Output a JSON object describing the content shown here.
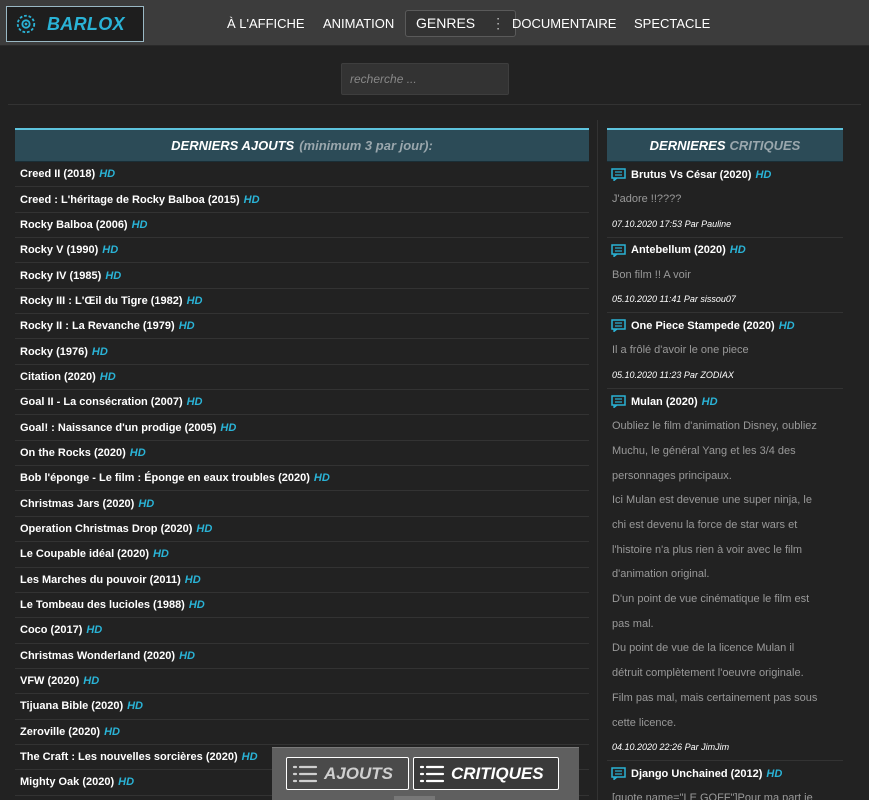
{
  "brand": {
    "name": "BARLOX"
  },
  "nav": [
    {
      "label": "À L'AFFICHE"
    },
    {
      "label": "ANIMATION"
    },
    {
      "label": "GENRES"
    },
    {
      "label": "DOCUMENTAIRE"
    },
    {
      "label": "SPECTACLE"
    }
  ],
  "search": {
    "placeholder": "recherche ..."
  },
  "latest": {
    "title": "DERNIERS AJOUTS",
    "subtitle": "(minimum 3 par jour):",
    "items": [
      {
        "title": "Creed II (2018)",
        "badge": "HD"
      },
      {
        "title": "Creed : L'héritage de Rocky Balboa (2015)",
        "badge": "HD"
      },
      {
        "title": "Rocky Balboa (2006)",
        "badge": "HD"
      },
      {
        "title": "Rocky V (1990)",
        "badge": "HD"
      },
      {
        "title": "Rocky IV (1985)",
        "badge": "HD"
      },
      {
        "title": "Rocky III : L'Œil du Tigre (1982)",
        "badge": "HD"
      },
      {
        "title": "Rocky II : La Revanche (1979)",
        "badge": "HD"
      },
      {
        "title": "Rocky (1976)",
        "badge": "HD"
      },
      {
        "title": "Citation (2020)",
        "badge": "HD"
      },
      {
        "title": "Goal II - La consécration (2007)",
        "badge": "HD"
      },
      {
        "title": "Goal! : Naissance d'un prodige (2005)",
        "badge": "HD"
      },
      {
        "title": "On the Rocks (2020)",
        "badge": "HD"
      },
      {
        "title": "Bob l'éponge - Le film : Éponge en eaux troubles (2020)",
        "badge": "HD"
      },
      {
        "title": "Christmas Jars (2020)",
        "badge": "HD"
      },
      {
        "title": "Operation Christmas Drop (2020)",
        "badge": "HD"
      },
      {
        "title": "Le Coupable idéal (2020)",
        "badge": "HD"
      },
      {
        "title": "Les Marches du pouvoir (2011)",
        "badge": "HD"
      },
      {
        "title": "Le Tombeau des lucioles (1988)",
        "badge": "HD"
      },
      {
        "title": "Coco (2017)",
        "badge": "HD"
      },
      {
        "title": "Christmas Wonderland (2020)",
        "badge": "HD"
      },
      {
        "title": "VFW (2020)",
        "badge": "HD"
      },
      {
        "title": "Tijuana Bible (2020)",
        "badge": "HD"
      },
      {
        "title": "Zeroville (2020)",
        "badge": "HD"
      },
      {
        "title": "The Craft : Les nouvelles sorcières (2020)",
        "badge": "HD"
      },
      {
        "title": "Mighty Oak (2020)",
        "badge": "HD"
      }
    ]
  },
  "critiques": {
    "title": "DERNIERES",
    "subtitle": "CRITIQUES",
    "reviews": [
      {
        "movie": "Brutus Vs César (2020)",
        "badge": "HD",
        "lines": [
          "J'adore !!????"
        ],
        "meta": "07.10.2020 17:53 Par Pauline"
      },
      {
        "movie": "Antebellum (2020)",
        "badge": "HD",
        "lines": [
          "Bon film !! A voir"
        ],
        "meta": "05.10.2020 11:41 Par sissou07"
      },
      {
        "movie": "One Piece Stampede (2020)",
        "badge": "HD",
        "lines": [
          "Il a frôlé d'avoir le one piece"
        ],
        "meta": "05.10.2020 11:23 Par ZODIAX"
      },
      {
        "movie": "Mulan (2020)",
        "badge": "HD",
        "lines": [
          "Oubliez le film d'animation Disney, oubliez",
          "Muchu, le général Yang et les 3/4 des",
          "personnages principaux.",
          "Ici Mulan est devenue une super ninja, le",
          "chi est devenu la force de star wars et",
          "l'histoire n'a plus rien à voir avec le film",
          "d'animation original.",
          "D'un point de vue cinématique le film est",
          "pas mal.",
          "Du point de vue de la licence Mulan il",
          "détruit complètement l'oeuvre originale.",
          "Film pas mal, mais certainement pas sous",
          "cette licence."
        ],
        "meta": "04.10.2020 22:26 Par JimJim"
      },
      {
        "movie": "Django Unchained (2012)",
        "badge": "HD",
        "lines": [
          "[quote name=\"LE GOFF\"]Pour ma part je"
        ],
        "meta": ""
      }
    ]
  },
  "tabs": {
    "ajouts": "AJOUTS",
    "critiques": "CRITIQUES"
  },
  "colors": {
    "accent": "#2ab3d6",
    "header_bg": "#2c4b57",
    "page_bg": "#222222"
  },
  "icons": {
    "logo": "gear-icon",
    "review": "comment-icon",
    "tab": "list-icon",
    "genres_menu": "dots-vertical-icon"
  }
}
